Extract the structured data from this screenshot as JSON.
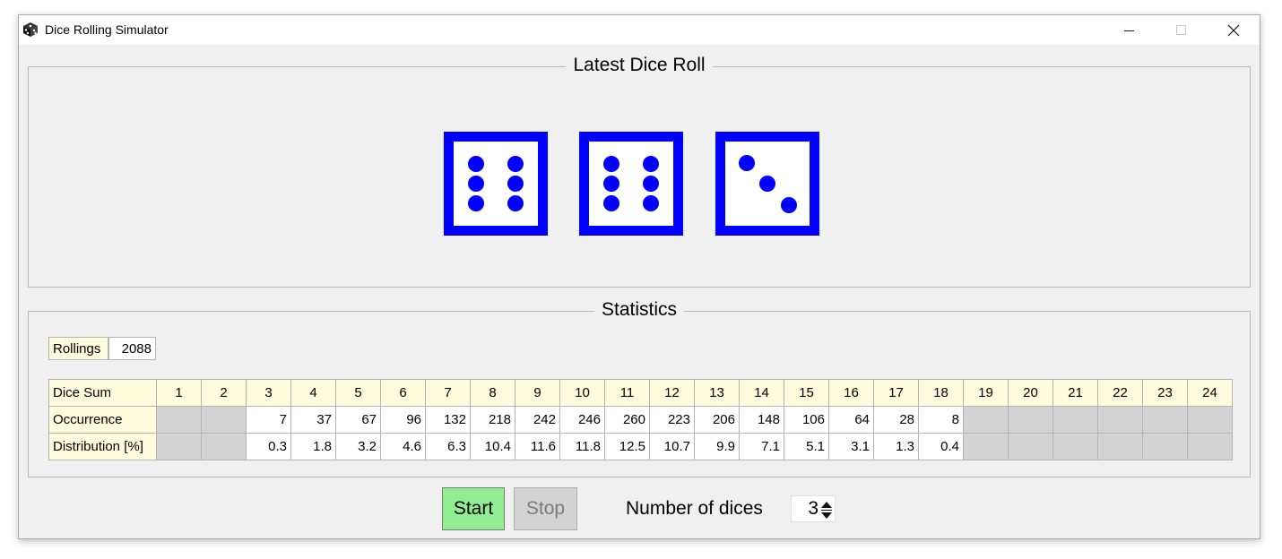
{
  "window": {
    "title": "Dice Rolling Simulator",
    "icon": "dice-icon",
    "controls": [
      "minimize-icon",
      "maximize-icon",
      "close-icon"
    ]
  },
  "latest_roll": {
    "title": "Latest Dice Roll",
    "dice": [
      6,
      6,
      3
    ],
    "color": "#0000ff"
  },
  "statistics": {
    "title": "Statistics",
    "rollings_label": "Rollings",
    "rollings_value": "2088",
    "row_labels": {
      "sum": "Dice Sum",
      "occurrence": "Occurrence",
      "distribution": "Distribution [%]"
    },
    "sums": [
      "1",
      "2",
      "3",
      "4",
      "5",
      "6",
      "7",
      "8",
      "9",
      "10",
      "11",
      "12",
      "13",
      "14",
      "15",
      "16",
      "17",
      "18",
      "19",
      "20",
      "21",
      "22",
      "23",
      "24"
    ],
    "occurrence": [
      null,
      null,
      "7",
      "37",
      "67",
      "96",
      "132",
      "218",
      "242",
      "246",
      "260",
      "223",
      "206",
      "148",
      "106",
      "64",
      "28",
      "8",
      null,
      null,
      null,
      null,
      null,
      null
    ],
    "distribution": [
      null,
      null,
      "0.3",
      "1.8",
      "3.2",
      "4.6",
      "6.3",
      "10.4",
      "11.6",
      "11.8",
      "12.5",
      "10.7",
      "9.9",
      "7.1",
      "5.1",
      "3.1",
      "1.3",
      "0.4",
      null,
      null,
      null,
      null,
      null,
      null
    ],
    "header_color": "#fffbdc",
    "empty_cell_color": "#d3d3d3"
  },
  "controls": {
    "start_label": "Start",
    "start_color": "#90ee90",
    "stop_label": "Stop",
    "stop_enabled": false,
    "dice_count_label": "Number of dices",
    "dice_count_value": "3"
  }
}
